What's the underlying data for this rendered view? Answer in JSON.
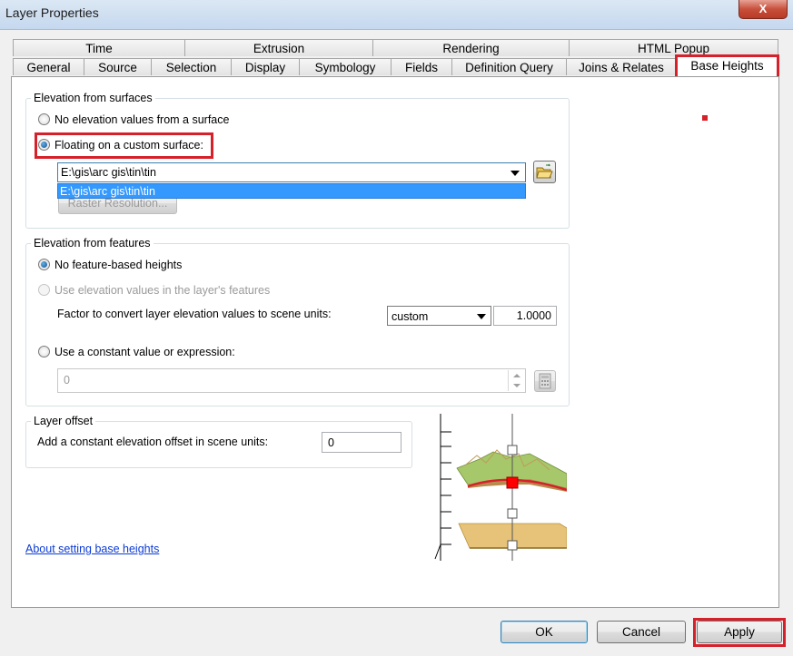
{
  "window": {
    "title": "Layer Properties",
    "close_label": "X"
  },
  "tabs_top": [
    "Time",
    "Extrusion",
    "Rendering",
    "HTML Popup"
  ],
  "tabs_bottom": [
    "General",
    "Source",
    "Selection",
    "Display",
    "Symbology",
    "Fields",
    "Definition Query",
    "Joins & Relates",
    "Base Heights"
  ],
  "surfaces": {
    "legend": "Elevation from surfaces",
    "option_none": "No elevation values from a surface",
    "option_floating": "Floating on a custom surface:",
    "surface_value": "E:\\gis\\arc gis\\tin\\tin",
    "dropdown_option": "E:\\gis\\arc gis\\tin\\tin",
    "raster_button": "Raster Resolution..."
  },
  "features": {
    "legend": "Elevation from features",
    "option_none": "No feature-based heights",
    "option_layer": "Use elevation values in the layer's features",
    "factor_label": "Factor to convert layer elevation values to scene units:",
    "factor_unit": "custom",
    "factor_value": "1.0000",
    "option_constant": "Use a constant value or expression:",
    "constant_value": "0"
  },
  "offset": {
    "legend": "Layer offset",
    "label": "Add a constant elevation offset in scene units:",
    "value": "0"
  },
  "help_link": "About setting base heights",
  "buttons": {
    "ok": "OK",
    "cancel": "Cancel",
    "apply": "Apply"
  }
}
